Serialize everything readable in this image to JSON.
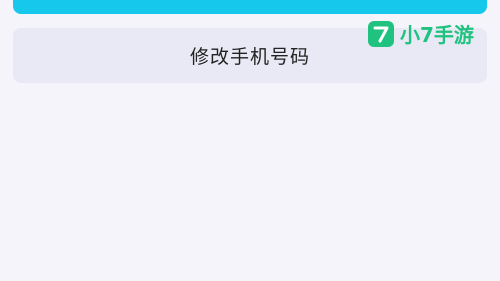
{
  "colors": {
    "background": "#f4f4fa",
    "top_bar": "#15c8ec",
    "button_bg": "#e8e9f4",
    "watermark": "#1fc27f"
  },
  "actions": {
    "change_phone_label": "修改手机号码"
  },
  "watermark": {
    "logo_icon": "seven-logo-icon",
    "text": "小7手游"
  }
}
